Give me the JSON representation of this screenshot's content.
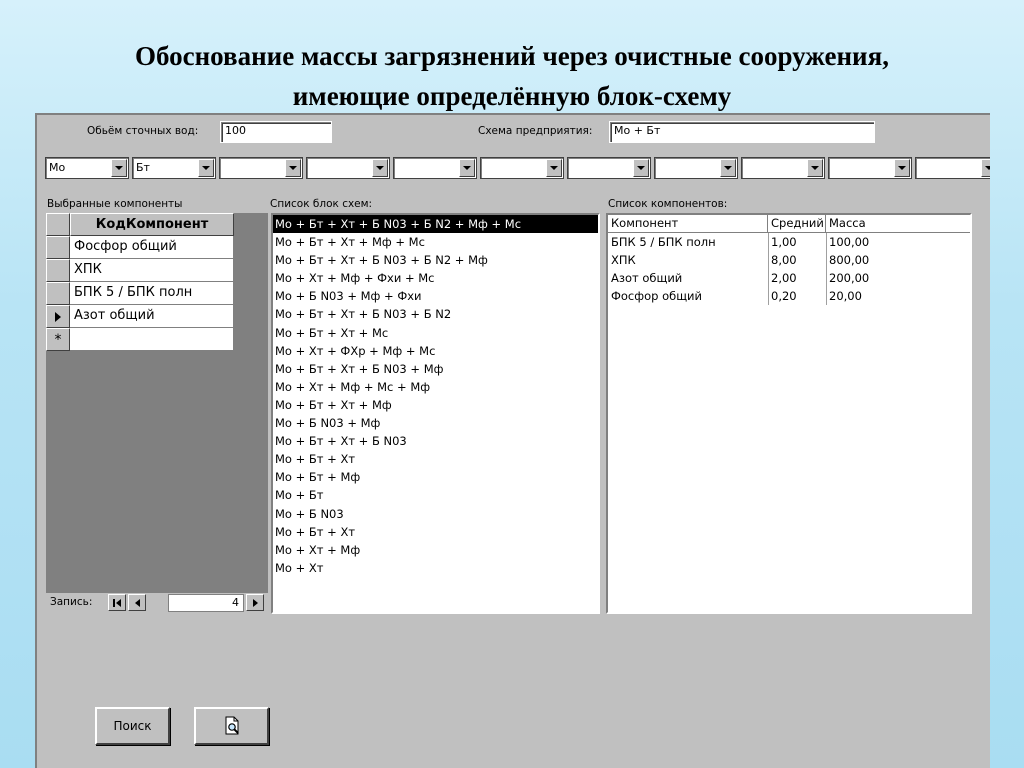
{
  "slide": {
    "title_line1": "Обоснование массы загрязнений через очистные сооружения,",
    "title_line2": "имеющие определённую блок-схему"
  },
  "form": {
    "volume_label": "Обьём сточных вод:",
    "volume_value": "100",
    "scheme_label": "Схема предприятия:",
    "scheme_value": "Мо + Бт",
    "combos": [
      "Мо",
      "Бт",
      "",
      "",
      "",
      "",
      "",
      "",
      "",
      "",
      "",
      ""
    ],
    "selected_components": {
      "label": "Выбранные компоненты",
      "header": "КодКомпонент",
      "rows": [
        "Фосфор общий",
        "ХПК",
        "БПК 5 / БПК полн",
        "Азот общий"
      ],
      "current_row_index": 3,
      "new_row_marker": "*",
      "record_label": "Запись:",
      "record_number": "4"
    },
    "schemes_list": {
      "label": "Список блок схем:",
      "selected_index": 0,
      "items": [
        "Мо + Бт + Хт + Б N03 + Б N2 + Мф + Мс",
        "Мо + Бт + Хт + Мф + Мс",
        "Мо + Бт + Хт + Б N03 + Б N2 + Мф",
        "Мо + Хт + Мф + Фхи + Мс",
        "Мо + Б N03 + Мф + Фхи",
        "Мо + Бт + Хт + Б N03 + Б N2",
        "Мо + Бт + Хт + Мс",
        "Мо + Хт + ФХр + Мф + Мс",
        "Мо + Бт + Хт + Б N03 + Мф",
        "Мо + Хт + Мф + Мс + Мф",
        "Мо + Бт + Хт + Мф",
        "Мо + Б N03 + Мф",
        "Мо + Бт + Хт + Б N03",
        "Мо + Бт + Хт",
        "Мо + Бт + Мф",
        "Мо + Бт",
        "Мо + Б N03",
        "Мо + Бт + Хт",
        "Мо + Хт + Мф",
        "Мо + Хт"
      ]
    },
    "components_list": {
      "label": "Список компонентов:",
      "columns": [
        "Компонент",
        "Средний",
        "Масса"
      ],
      "rows": [
        [
          "БПК 5 / БПК полн",
          "1,00",
          "100,00"
        ],
        [
          "ХПК",
          "8,00",
          "800,00"
        ],
        [
          "Азот общий",
          "2,00",
          "200,00"
        ],
        [
          "Фосфор общий",
          "0,20",
          "20,00"
        ]
      ]
    },
    "search_button": "Поиск",
    "preview_icon": "print-preview-icon"
  }
}
